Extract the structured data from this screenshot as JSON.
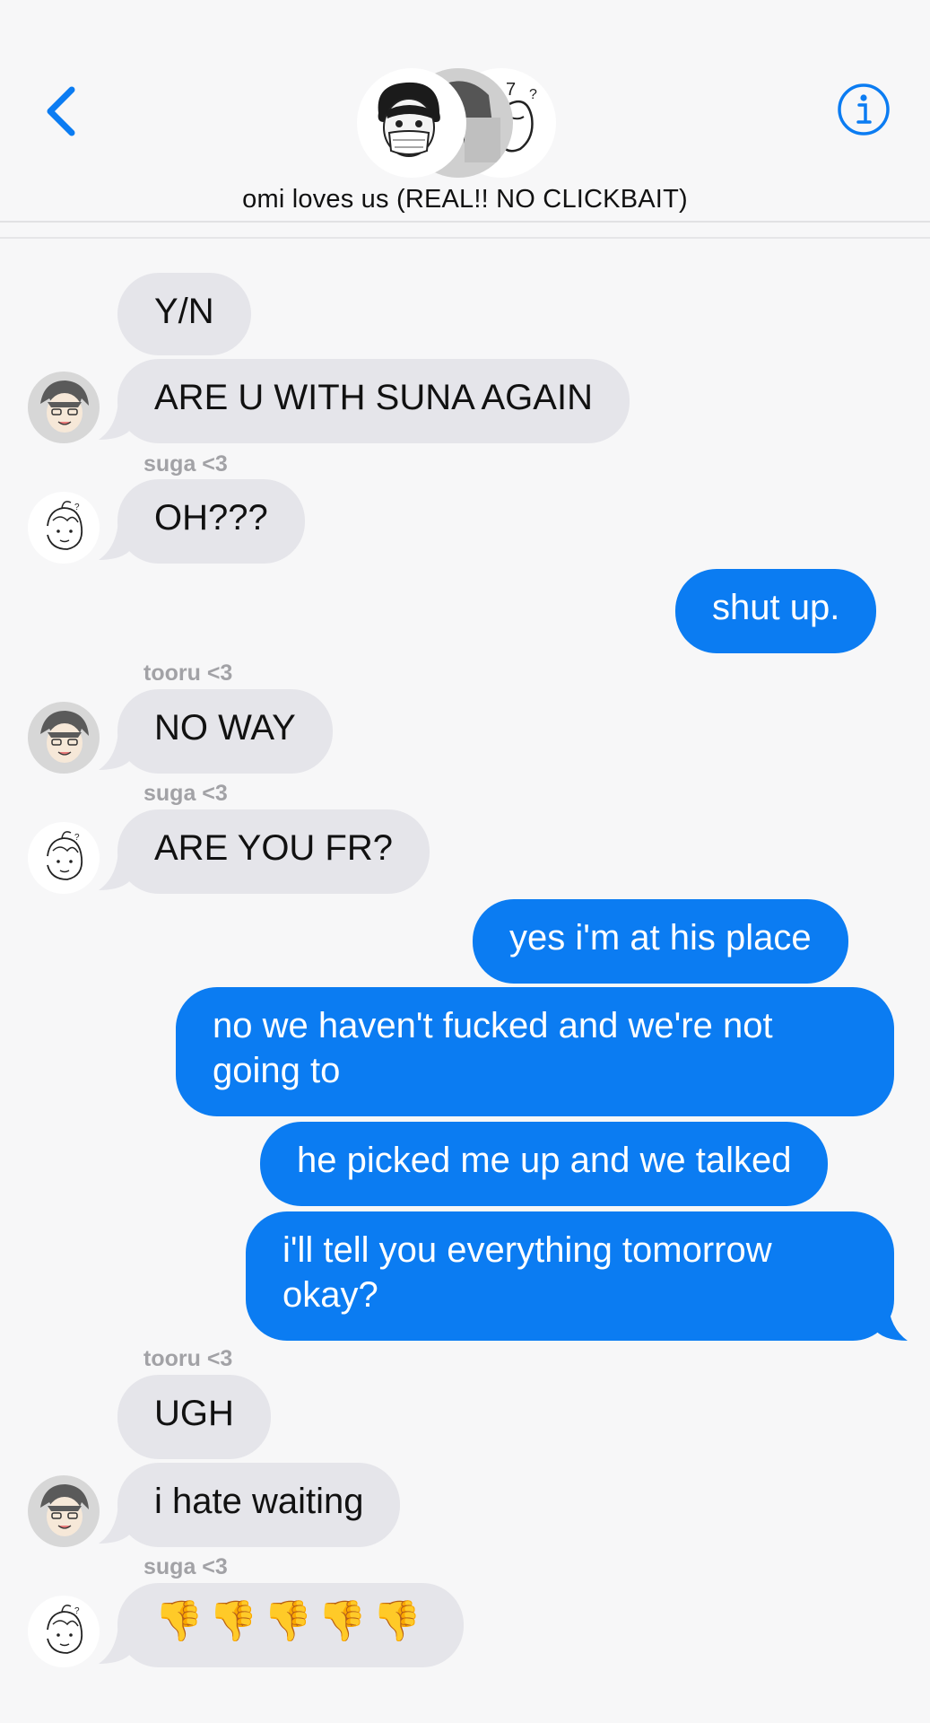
{
  "header": {
    "back_icon": "chevron-left-icon",
    "info_icon": "info-circle-icon",
    "title": "omi loves us (REAL!! NO CLICKBAIT)",
    "accent_color": "#0b7cf2"
  },
  "messages": [
    {
      "from": "tooru",
      "direction": "in",
      "text": "Y/N"
    },
    {
      "from": "tooru",
      "direction": "in",
      "text": "ARE U WITH SUNA AGAIN"
    },
    {
      "sender_label": "suga <3"
    },
    {
      "from": "suga",
      "direction": "in",
      "text": "OH???"
    },
    {
      "from": "me",
      "direction": "out",
      "text": "shut up."
    },
    {
      "sender_label": "tooru <3"
    },
    {
      "from": "tooru",
      "direction": "in",
      "text": "NO WAY"
    },
    {
      "sender_label": "suga <3"
    },
    {
      "from": "suga",
      "direction": "in",
      "text": "ARE YOU FR?"
    },
    {
      "from": "me",
      "direction": "out",
      "text": "yes i'm at his place"
    },
    {
      "from": "me",
      "direction": "out",
      "text": "no we haven't fucked and we're not going to"
    },
    {
      "from": "me",
      "direction": "out",
      "text": "he picked me up and we talked"
    },
    {
      "from": "me",
      "direction": "out",
      "text": "i'll tell you everything tomorrow okay?"
    },
    {
      "sender_label": "tooru <3"
    },
    {
      "from": "tooru",
      "direction": "in",
      "text": "UGH"
    },
    {
      "from": "tooru",
      "direction": "in",
      "text": "i hate waiting"
    },
    {
      "sender_label": "suga <3"
    },
    {
      "from": "suga",
      "direction": "in",
      "text": "👎👎👎👎👎"
    }
  ],
  "colors": {
    "incoming_bubble": "#e5e5ea",
    "outgoing_bubble": "#0b7cf2",
    "sender_label": "#a2a2a6",
    "background": "#f7f7f8"
  }
}
